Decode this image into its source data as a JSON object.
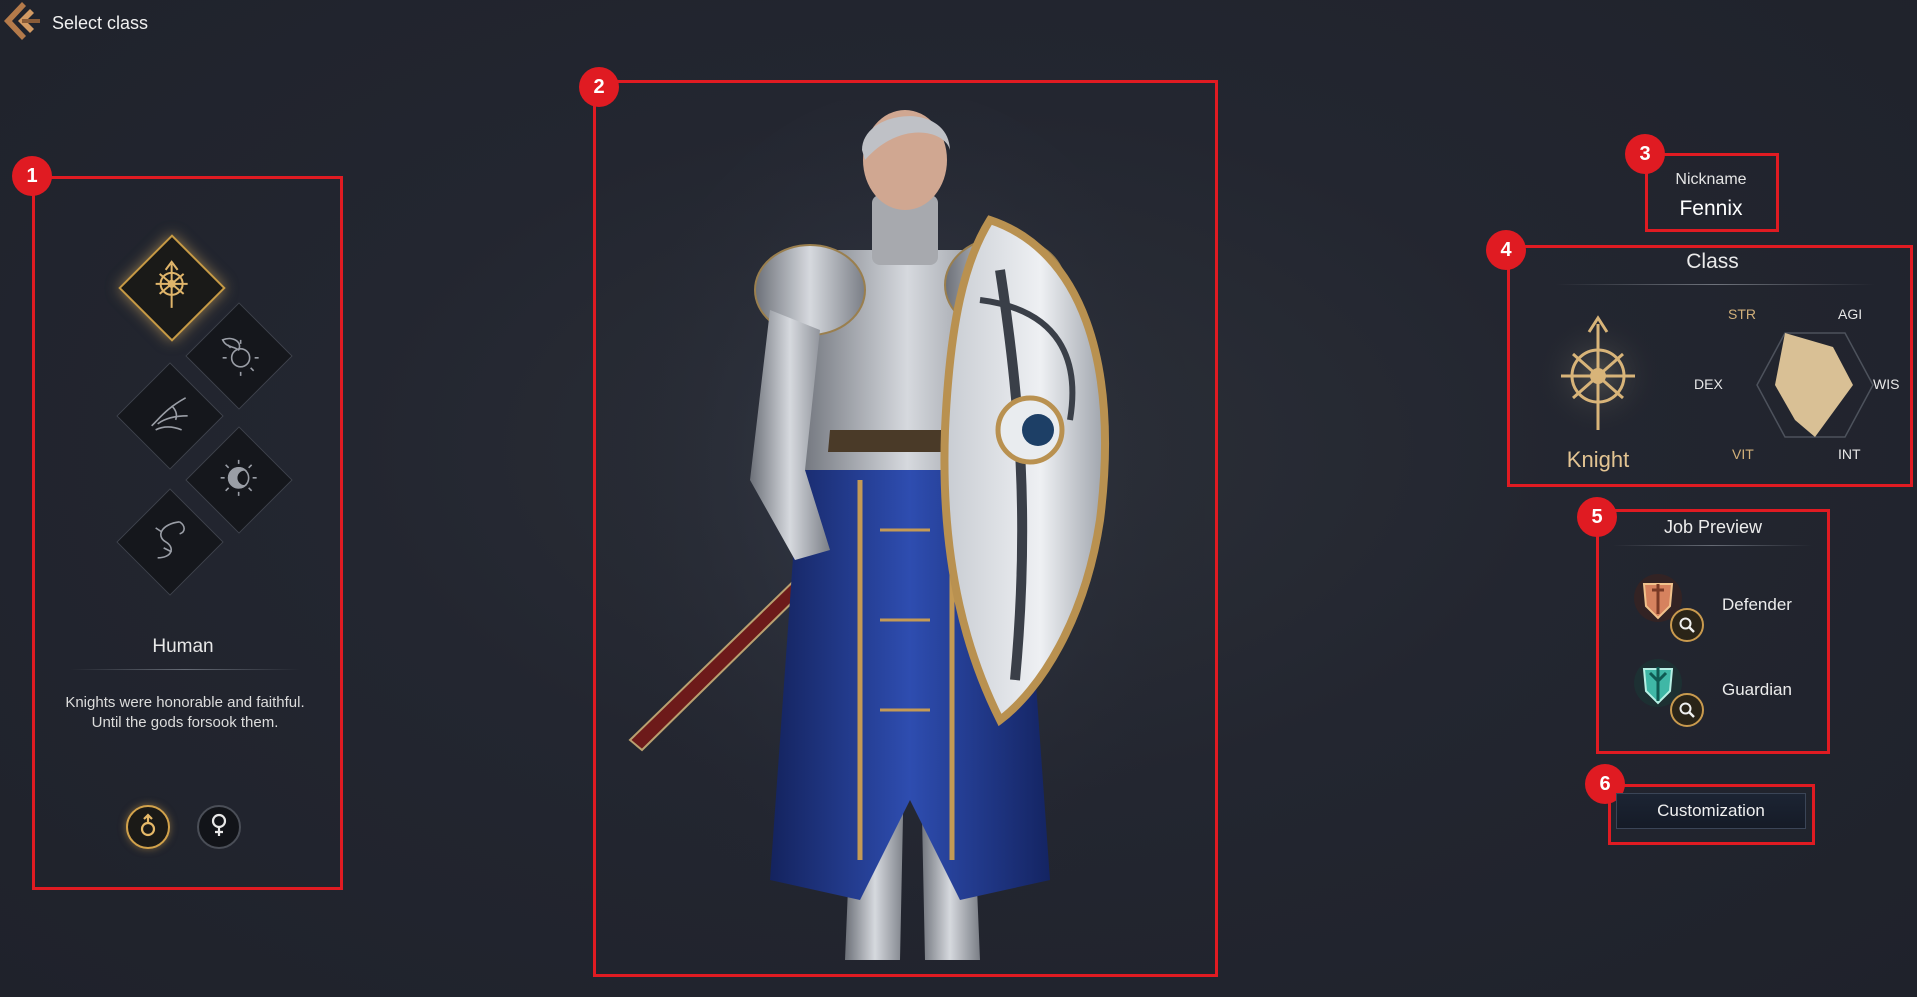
{
  "header": {
    "back_label": "Select class",
    "back_icon": "arrow-back-icon"
  },
  "race_panel": {
    "race_name": "Human",
    "description_line1": "Knights were honorable and faithful.",
    "description_line2": "Until the gods forsook them.",
    "classes": [
      {
        "icon": "knight-crest-icon",
        "selected": true
      },
      {
        "icon": "dragon-sun-icon",
        "selected": false
      },
      {
        "icon": "phoenix-icon",
        "selected": false
      },
      {
        "icon": "moon-sun-icon",
        "selected": false
      },
      {
        "icon": "serpent-icon",
        "selected": false
      }
    ],
    "genders": [
      {
        "icon": "male-symbol-icon",
        "selected": true
      },
      {
        "icon": "female-symbol-icon",
        "selected": false
      }
    ]
  },
  "nickname": {
    "label": "Nickname",
    "value": "Fennix"
  },
  "class_panel": {
    "title": "Class",
    "class_name": "Knight",
    "stats": {
      "str": "STR",
      "agi": "AGI",
      "wis": "WIS",
      "int": "INT",
      "vit": "VIT",
      "dex": "DEX"
    },
    "highlight_color": "#d2b07a"
  },
  "job_preview": {
    "title": "Job Preview",
    "jobs": [
      {
        "label": "Defender",
        "icon": "defender-icon"
      },
      {
        "label": "Guardian",
        "icon": "guardian-icon"
      }
    ]
  },
  "customization_label": "Customization",
  "markers": [
    "1",
    "2",
    "3",
    "4",
    "5",
    "6"
  ],
  "colors": {
    "accent_gold": "#c69a45",
    "annotation_red": "#e01b22",
    "background": "#232630"
  }
}
